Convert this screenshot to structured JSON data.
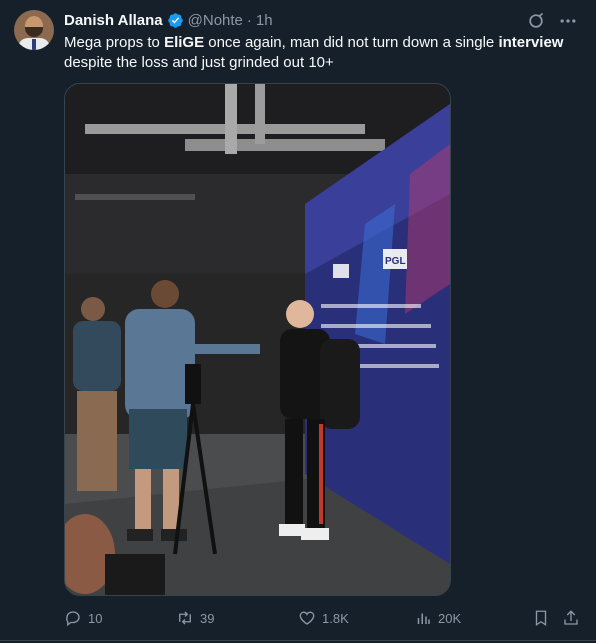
{
  "author": {
    "name": "Danish Allana",
    "handle": "@Nohte",
    "time": "1h"
  },
  "tweet": {
    "text_parts": [
      {
        "t": "Mega props to ",
        "b": false
      },
      {
        "t": "EliGE",
        "b": true
      },
      {
        "t": " once again, man did not turn down a single ",
        "b": false
      },
      {
        "t": "interview",
        "b": true
      },
      {
        "t": " despite the loss and just grinded out 10+",
        "b": false
      }
    ]
  },
  "media": {
    "backdrop_logo": "PGL"
  },
  "actions": {
    "replies": "10",
    "retweets": "39",
    "likes": "1.8K",
    "views": "20K"
  },
  "icons": {
    "verified": "verified-badge-icon",
    "grok": "grok-icon",
    "more": "more-icon",
    "reply": "reply-icon",
    "retweet": "retweet-icon",
    "like": "heart-icon",
    "views": "views-icon",
    "bookmark": "bookmark-icon",
    "share": "share-icon"
  },
  "colors": {
    "background": "#15202b",
    "text": "#f7f9f9",
    "muted": "#8b98a5",
    "verified": "#1d9bf0",
    "backdrop": "#2a2f7a"
  }
}
